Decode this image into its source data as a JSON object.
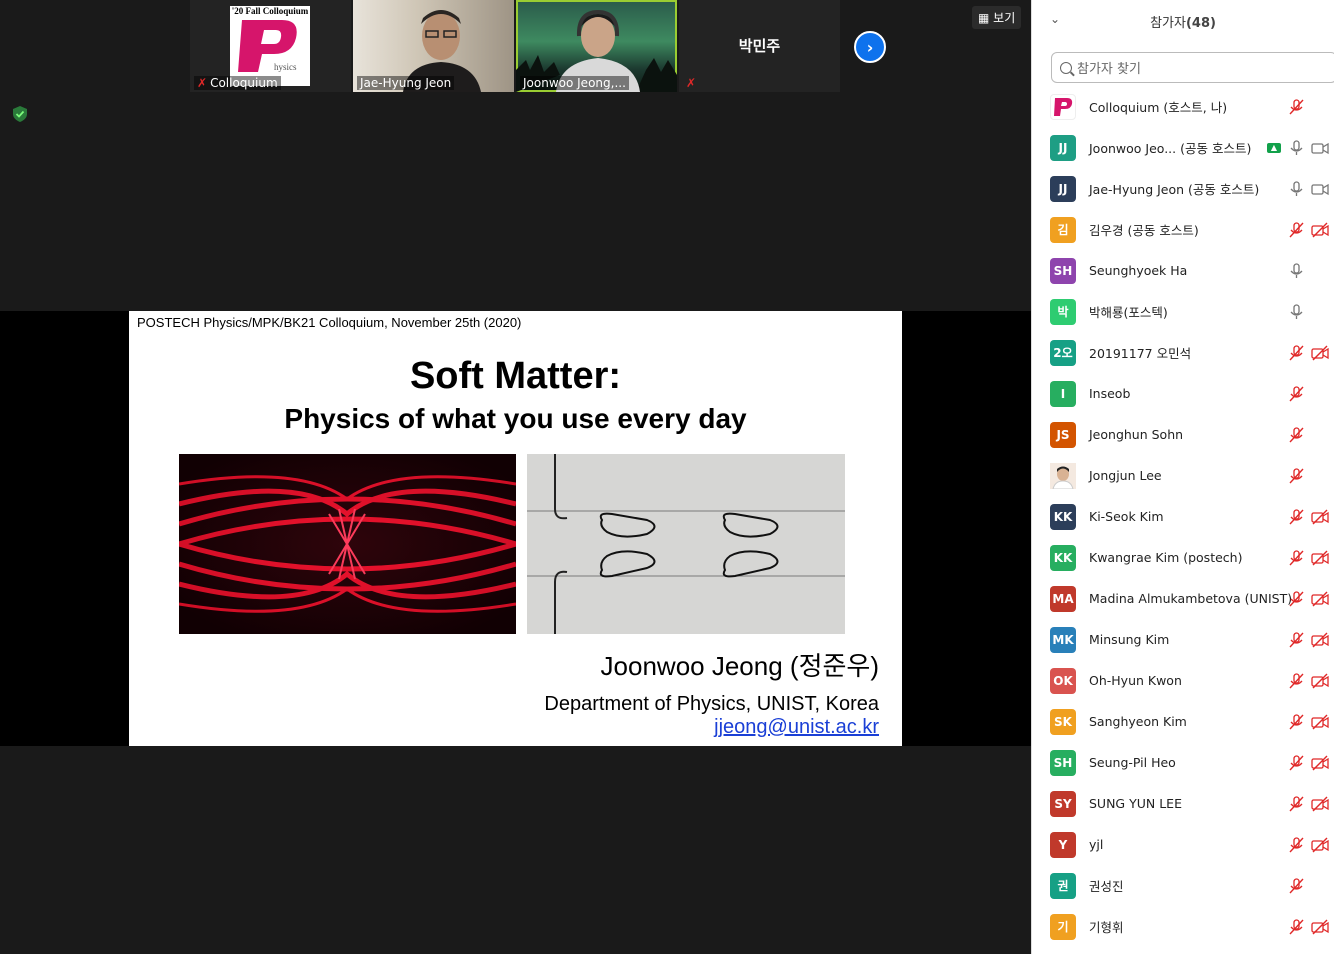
{
  "thumbnails": [
    {
      "name": "Colloquium",
      "logo_top": "'20 Fall Colloquium",
      "muted": true
    },
    {
      "name": "Jae-Hyung Jeon",
      "muted": false
    },
    {
      "name": "Joonwoo Jeong,...",
      "muted": false,
      "active": true
    },
    {
      "center_name": "박민주",
      "muted": true
    }
  ],
  "view_label": "보기",
  "slide": {
    "header": "POSTECH Physics/MPK/BK21 Colloquium, November 25th (2020)",
    "title": "Soft Matter:",
    "subtitle": "Physics of what you use every day",
    "author": "Joonwoo Jeong (정준우)",
    "dept": "Department of Physics, UNIST, Korea",
    "email": "jjeong@unist.ac.kr"
  },
  "panel": {
    "title": "참가자",
    "count": "(48)",
    "search_placeholder": "참가자 찾기",
    "participants": [
      {
        "initials": "P",
        "color": "#ffffff",
        "name": "Colloquium (호스트, 나)",
        "mic": "muted",
        "video": "none"
      },
      {
        "initials": "JJ",
        "color": "#1e9e84",
        "name": "Joonwoo Jeo... (공동 호스트)",
        "mic": "on",
        "video": "on",
        "sharing": true
      },
      {
        "initials": "JJ",
        "color": "#2c3e5a",
        "name": "Jae-Hyung Jeon (공동 호스트)",
        "mic": "on",
        "video": "on"
      },
      {
        "initials": "김",
        "color": "#f0a020",
        "name": "김우경 (공동 호스트)",
        "mic": "muted",
        "video": "off"
      },
      {
        "initials": "SH",
        "color": "#8e44ad",
        "name": "Seunghyoek Ha",
        "mic": "on",
        "video": "none"
      },
      {
        "initials": "박",
        "color": "#2ecc71",
        "name": "박해룡(포스텍)",
        "mic": "on",
        "video": "none"
      },
      {
        "initials": "2오",
        "color": "#16a085",
        "name": "20191177 오민석",
        "mic": "muted",
        "video": "off"
      },
      {
        "initials": "I",
        "color": "#27ae60",
        "name": "Inseob",
        "mic": "muted",
        "video": "none"
      },
      {
        "initials": "JS",
        "color": "#d35400",
        "name": "Jeonghun Sohn",
        "mic": "muted",
        "video": "none"
      },
      {
        "initials": "",
        "color": "#f2d7c6",
        "name": "Jongjun Lee",
        "mic": "muted",
        "video": "none",
        "photo": true
      },
      {
        "initials": "KK",
        "color": "#2c3e5a",
        "name": "Ki-Seok Kim",
        "mic": "muted",
        "video": "off"
      },
      {
        "initials": "KK",
        "color": "#27ae60",
        "name": "Kwangrae Kim (postech)",
        "mic": "muted",
        "video": "off"
      },
      {
        "initials": "MA",
        "color": "#c0392b",
        "name": "Madina Almukambetova (UNIST)",
        "mic": "muted",
        "video": "off"
      },
      {
        "initials": "MK",
        "color": "#2980b9",
        "name": "Minsung Kim",
        "mic": "muted",
        "video": "off"
      },
      {
        "initials": "OK",
        "color": "#d9534f",
        "name": "Oh-Hyun Kwon",
        "mic": "muted",
        "video": "off"
      },
      {
        "initials": "SK",
        "color": "#f0a020",
        "name": "Sanghyeon Kim",
        "mic": "muted",
        "video": "off"
      },
      {
        "initials": "SH",
        "color": "#27ae60",
        "name": "Seung-Pil Heo",
        "mic": "muted",
        "video": "off"
      },
      {
        "initials": "SY",
        "color": "#c0392b",
        "name": "SUNG YUN LEE",
        "mic": "muted",
        "video": "off"
      },
      {
        "initials": "Y",
        "color": "#c0392b",
        "name": "yjl",
        "mic": "muted",
        "video": "off"
      },
      {
        "initials": "권",
        "color": "#16a085",
        "name": "권성진",
        "mic": "muted",
        "video": "none"
      },
      {
        "initials": "기",
        "color": "#f0a020",
        "name": "기형휘",
        "mic": "muted",
        "video": "off"
      }
    ]
  }
}
